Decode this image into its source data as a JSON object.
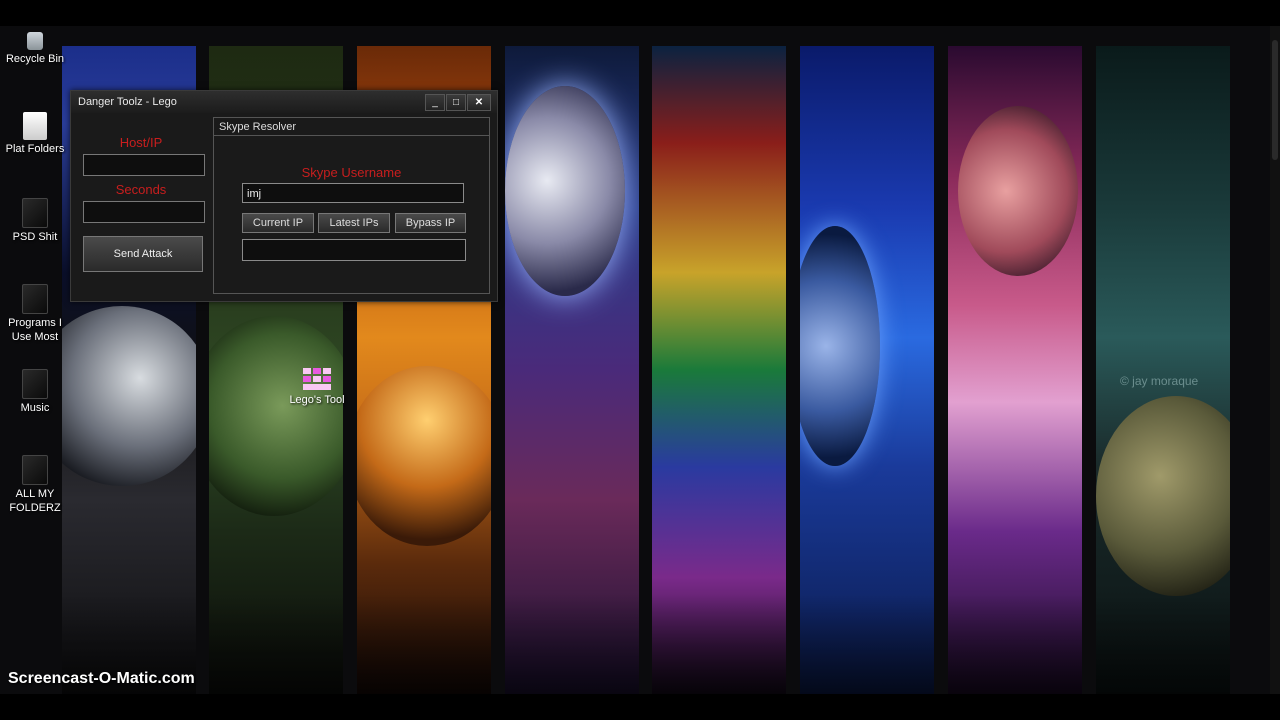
{
  "window": {
    "title": "Danger Toolz - Lego",
    "buttons": {
      "minimize": "_",
      "maximize": "□",
      "close": "✕"
    }
  },
  "left_pane": {
    "host_label": "Host/IP",
    "host_value": "",
    "seconds_label": "Seconds",
    "seconds_value": "",
    "send_button": "Send Attack"
  },
  "skype_resolver": {
    "group_title": "Skype Resolver",
    "username_label": "Skype Username",
    "username_value": "imj",
    "buttons": [
      "Current IP",
      "Latest IPs",
      "Bypass IP"
    ],
    "result_value": ""
  },
  "desktop_icons": [
    {
      "label": "Recycle Bin",
      "icon": "recycle-bin-icon"
    },
    {
      "label": "Plat Folders",
      "icon": "folder-icon"
    },
    {
      "label": "PSD Shit",
      "icon": "folder-icon"
    },
    {
      "label": "Programs I Use Most",
      "icon": "folder-icon"
    },
    {
      "label": "Music",
      "icon": "folder-icon"
    },
    {
      "label": "ALL MY FOLDERZ",
      "icon": "folder-icon"
    }
  ],
  "lego_icon": {
    "label": "Lego's Tool"
  },
  "watermark": "Screencast-O-Matic.com",
  "wallpaper_credit": "© jay moraque"
}
